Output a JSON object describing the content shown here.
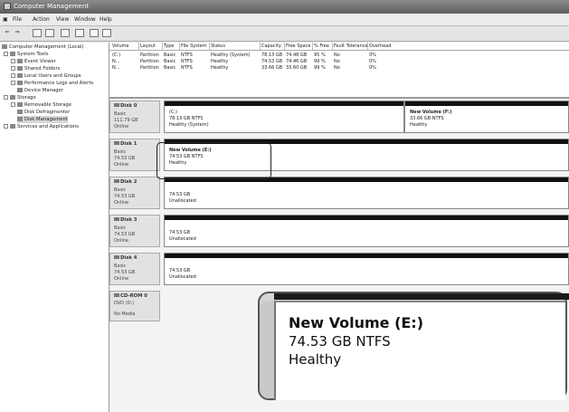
{
  "window": {
    "title": "Computer Management"
  },
  "menu": [
    "File",
    "Action",
    "View",
    "Window",
    "Help"
  ],
  "toolbar": {
    "back": "⇐",
    "forward": "⇒"
  },
  "tree": [
    {
      "label": "Computer Management (Local)",
      "depth": 0
    },
    {
      "label": "System Tools",
      "depth": 1
    },
    {
      "label": "Event Viewer",
      "depth": 2
    },
    {
      "label": "Shared Folders",
      "depth": 2
    },
    {
      "label": "Local Users and Groups",
      "depth": 2
    },
    {
      "label": "Performance Logs and Alerts",
      "depth": 2
    },
    {
      "label": "Device Manager",
      "depth": 2
    },
    {
      "label": "Storage",
      "depth": 1
    },
    {
      "label": "Removable Storage",
      "depth": 2
    },
    {
      "label": "Disk Defragmenter",
      "depth": 2
    },
    {
      "label": "Disk Management",
      "depth": 2,
      "selected": true
    },
    {
      "label": "Services and Applications",
      "depth": 1
    }
  ],
  "volume_table": {
    "headers": [
      "Volume",
      "Layout",
      "Type",
      "File System",
      "Status",
      "Capacity",
      "Free Space",
      "% Free",
      "Fault Tolerance",
      "Overhead"
    ],
    "rows": [
      [
        "(C:)",
        "Partition",
        "Basic",
        "NTFS",
        "Healthy (System)",
        "78.13 GB",
        "74.48 GB",
        "95 %",
        "No",
        "0%"
      ],
      [
        "N...",
        "Partition",
        "Basic",
        "NTFS",
        "Healthy",
        "74.53 GB",
        "74.46 GB",
        "99 %",
        "No",
        "0%"
      ],
      [
        "N...",
        "Partition",
        "Basic",
        "NTFS",
        "Healthy",
        "33.66 GB",
        "33.60 GB",
        "99 %",
        "No",
        "0%"
      ]
    ]
  },
  "disks": [
    {
      "name": "Disk 0",
      "type": "Basic",
      "size": "111.79 GB",
      "status": "Online",
      "partitions": [
        {
          "title": "(C:)",
          "line1": "78.13 GB NTFS",
          "line2": "Healthy (System)"
        },
        {
          "title": "New Volume  (F:)",
          "line1": "33.66 GB NTFS",
          "line2": "Healthy"
        }
      ]
    },
    {
      "name": "Disk 1",
      "type": "Basic",
      "size": "74.53 GB",
      "status": "Online",
      "partitions": [
        {
          "title": "New Volume  (E:)",
          "line1": "74.53 GB NTFS",
          "line2": "Healthy"
        }
      ]
    },
    {
      "name": "Disk 2",
      "type": "Basic",
      "size": "74.53 GB",
      "status": "Online",
      "partitions": [
        {
          "title": "",
          "line1": "74.53 GB",
          "line2": "Unallocated"
        }
      ]
    },
    {
      "name": "Disk 3",
      "type": "Basic",
      "size": "74.53 GB",
      "status": "Online",
      "partitions": [
        {
          "title": "",
          "line1": "74.53 GB",
          "line2": "Unallocated"
        }
      ]
    },
    {
      "name": "Disk 4",
      "type": "Basic",
      "size": "74.53 GB",
      "status": "Online",
      "partitions": [
        {
          "title": "",
          "line1": "74.53 GB",
          "line2": "Unallocated"
        }
      ]
    },
    {
      "name": "CD-ROM 0",
      "type": "DVD (D:)",
      "size": "",
      "status": "No Media",
      "partitions": []
    }
  ],
  "zoom_callout": {
    "title": "New Volume  (E:)",
    "line1": "74.53 GB NTFS",
    "line2": "Healthy"
  }
}
